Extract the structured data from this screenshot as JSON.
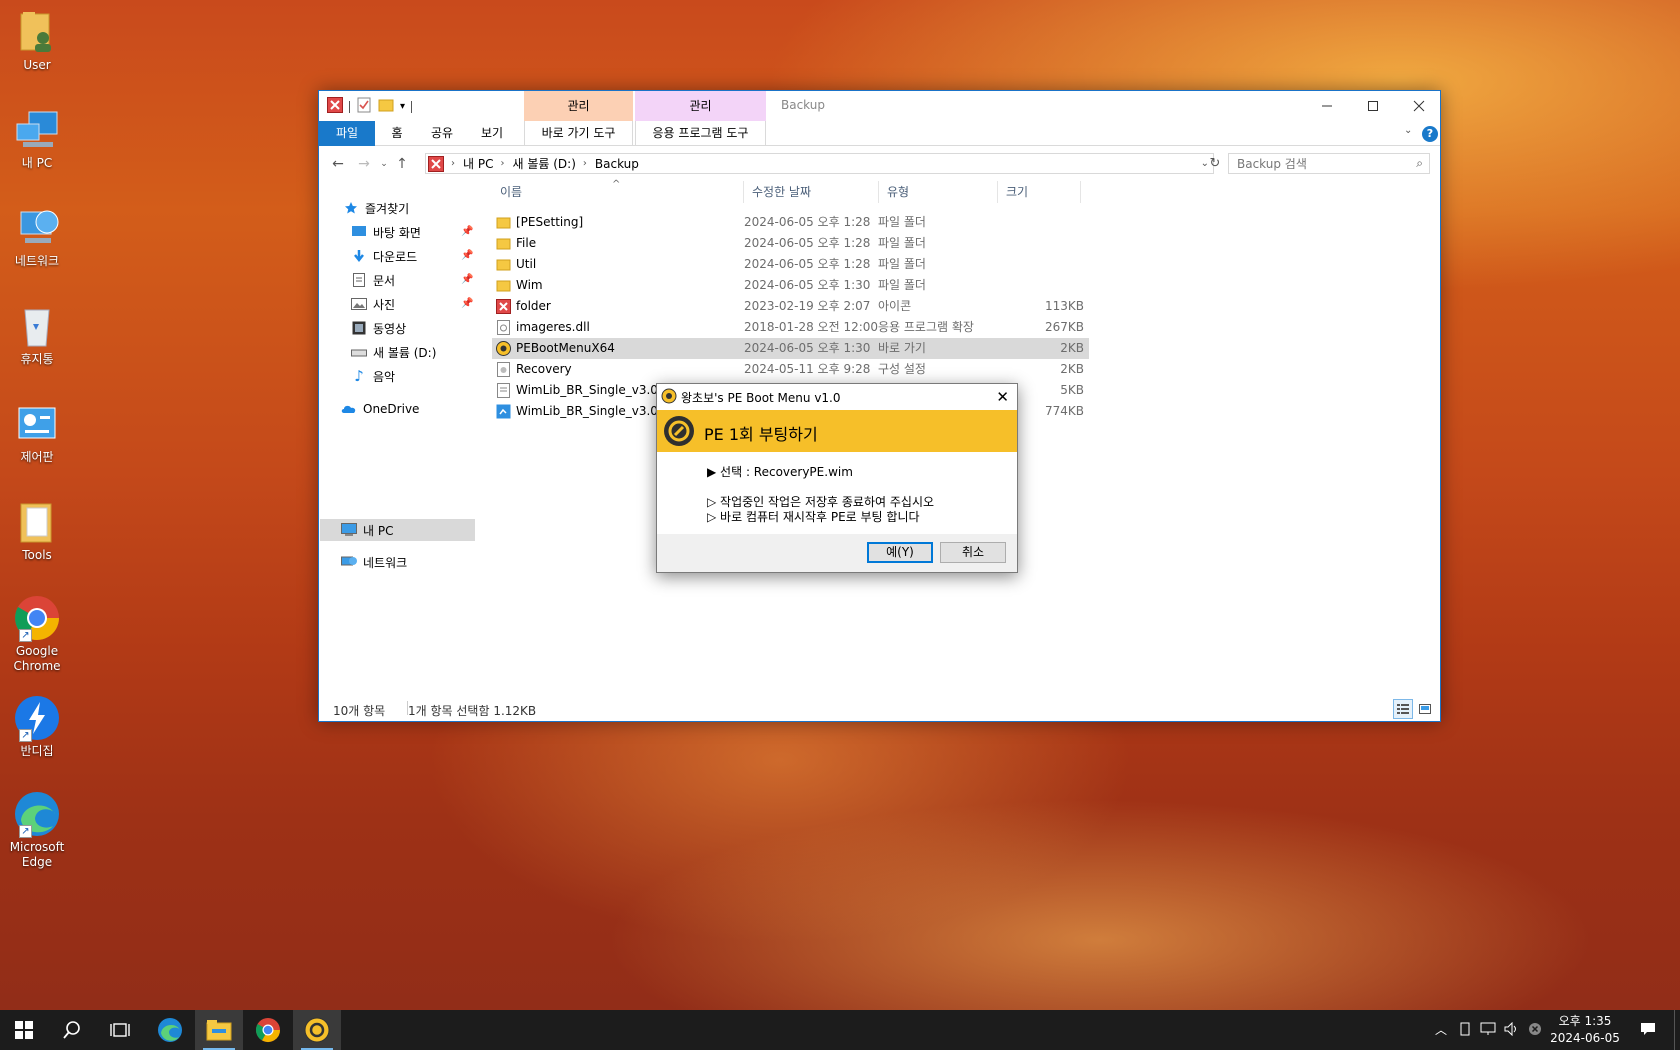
{
  "desktop": {
    "icons": [
      {
        "label": "User"
      },
      {
        "label": "내 PC"
      },
      {
        "label": "네트워크"
      },
      {
        "label": "휴지통"
      },
      {
        "label": "제어판"
      },
      {
        "label": "Tools"
      },
      {
        "label": "Google Chrome"
      },
      {
        "label": "반디집"
      },
      {
        "label": "Microsoft Edge"
      }
    ]
  },
  "explorer": {
    "title": "Backup",
    "context_tabs": [
      {
        "head": "관리",
        "sub": "바로 가기 도구",
        "color": "#fcd0b4"
      },
      {
        "head": "관리",
        "sub": "응용 프로그램 도구",
        "color": "#f3d4f8"
      }
    ],
    "ribbon_tabs": [
      "파일",
      "홈",
      "공유",
      "보기"
    ],
    "address": {
      "crumbs": [
        "내 PC",
        "새 볼륨 (D:)",
        "Backup"
      ]
    },
    "search": {
      "placeholder": "Backup 검색"
    },
    "nav": {
      "quick_access": "즐겨찾기",
      "pinned": [
        "바탕 화면",
        "다운로드",
        "문서",
        "사진"
      ],
      "others": [
        "동영상",
        "새 볼륨 (D:)",
        "음악"
      ],
      "onedrive": "OneDrive",
      "this_pc": "내 PC",
      "network": "네트워크"
    },
    "columns": {
      "name": "이름",
      "date": "수정한 날짜",
      "type": "유형",
      "size": "크기"
    },
    "rows": [
      {
        "name": "[PESetting]",
        "date": "2024-06-05 오후 1:28",
        "type": "파일 폴더",
        "size": ""
      },
      {
        "name": "File",
        "date": "2024-06-05 오후 1:28",
        "type": "파일 폴더",
        "size": ""
      },
      {
        "name": "Util",
        "date": "2024-06-05 오후 1:28",
        "type": "파일 폴더",
        "size": ""
      },
      {
        "name": "Wim",
        "date": "2024-06-05 오후 1:30",
        "type": "파일 폴더",
        "size": ""
      },
      {
        "name": "folder",
        "date": "2023-02-19 오후 2:07",
        "type": "아이콘",
        "size": "113KB"
      },
      {
        "name": "imageres.dll",
        "date": "2018-01-28 오전 12:00",
        "type": "응용 프로그램 확장",
        "size": "267KB"
      },
      {
        "name": "PEBootMenuX64",
        "date": "2024-06-05 오후 1:30",
        "type": "바로 가기",
        "size": "2KB"
      },
      {
        "name": "Recovery",
        "date": "2024-05-11 오후 9:28",
        "type": "구성 설정",
        "size": "2KB"
      },
      {
        "name": "WimLib_BR_Single_v3.0_D",
        "date": "",
        "type": "",
        "size": "5KB"
      },
      {
        "name": "WimLib_BR_Single_v3.0_D",
        "date": "",
        "type": "",
        "size": "774KB"
      }
    ],
    "status": {
      "count": "10개 항목",
      "selection": "1개 항목 선택함 1.12KB"
    }
  },
  "dialog": {
    "title": "왕초보's PE Boot Menu v1.0",
    "banner": "PE 1회 부팅하기",
    "selection": "▶ 선택 : RecoveryPE.wim",
    "notice1": "▷ 작업중인 작업은 저장후 종료하여 주십시오",
    "notice2": "▷ 바로 컴퓨터 재시작후 PE로 부팅 합니다",
    "ok_label": "예(Y)",
    "cancel_label": "취소",
    "banner_color": "#f6bf29"
  },
  "taskbar": {
    "clock_time": "오후 1:35",
    "clock_date": "2024-06-05"
  }
}
